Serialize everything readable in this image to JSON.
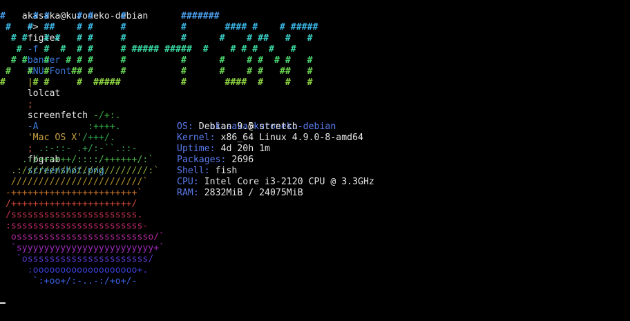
{
  "prompt": {
    "user_host": "akasaka@kuroneko-debian",
    "path": "~>",
    "cmd_figlet": "figlet",
    "arg_f": "-f",
    "arg_banner": "banner",
    "arg_font": "XNU-Font",
    "pipe": "|",
    "cmd_lolcat": "lolcat",
    "sep1": ";",
    "cmd_screenfetch": "screenfetch",
    "arg_A": "-A",
    "arg_os": "'Mac OS X'",
    "sep2": ";",
    "cmd_fbgrab": "fbgrab",
    "arg_file": "screenshot.png"
  },
  "banner_lines": [
    "#     # #     # #     #          #######",
    " #   #  ##    # #     #          #       #### #    # #####",
    "  # #   # #   # #     #          #      #    # ##   #   #",
    "   #    #  #  # #     # ##### #####  #    # # #  #   #",
    "  # #   #   # # #     #          #      #    # #  # #   #",
    " #   #  #    ## #     #          #      #    # #   ##   #",
    "#     # #     #  #####           #       ####  #    #   #"
  ],
  "logo_lines": [
    "                 -/+:.",
    "                :++++.",
    "               /+++/.",
    "       .:-::- .+/:-``.::-",
    "    .:/++++++/::::/++++++/:`",
    "  .:///////////////////////:`",
    "  ////////////////////////`",
    " -+++++++++++++++++++++++`",
    " /++++++++++++++++++++++/",
    " /sssssssssssssssssssssss.",
    " :ssssssssssssssssssssssss-",
    "  osssssssssssssssssssssssso/`",
    "  `syyyyyyyyyyyyyyyyyyyyyyyy+`",
    "   `ossssssssssssssssssssss/",
    "     :ooooooooooooooooooo+.",
    "      `:+oo+/:-..-:/+o+/-"
  ],
  "logo_colors": [
    "#3ba83b",
    "#34b044",
    "#2ea84c",
    "#3aa65a",
    "#4bb84f",
    "#8aa83a",
    "#b3962e",
    "#c9742a",
    "#d24a36",
    "#c4324c",
    "#c02a6a",
    "#b02a9a",
    "#9a2ab8",
    "#5a3ad0",
    "#3a40d8",
    "#3a60e0"
  ],
  "banner_colors": [
    "#4aa0f0",
    "#3ab8e8",
    "#3ad0c8",
    "#3ad8a0",
    "#4ad870",
    "#6ad050",
    "#8ad040"
  ],
  "prompt_colors": {
    "user_host": "#e6e6e6",
    "figlet": "#e6e6e6",
    "args": "#3a78d8",
    "pipe": "#d8c84a",
    "lolcat": "#e6e6e6",
    "sep": "#c85a3a",
    "screenfetch": "#e6e6e6",
    "string": "#c8a040",
    "fbgrab": "#e6e6e6",
    "file": "#5ab8e8"
  },
  "info": {
    "user": "akasaka",
    "at": "@",
    "host": "kuroneko-debian",
    "rows": [
      {
        "key": "OS:",
        "value": "Debian 9.5 stretch"
      },
      {
        "key": "Kernel:",
        "value": "x86_64 Linux 4.9.0-8-amd64"
      },
      {
        "key": "Uptime:",
        "value": "4d 20h 1m"
      },
      {
        "key": "Packages:",
        "value": "2696"
      },
      {
        "key": "Shell:",
        "value": "fish"
      },
      {
        "key": "CPU:",
        "value": "Intel Core i3-2120 CPU @ 3.3GHz"
      },
      {
        "key": "RAM:",
        "value": "2832MiB / 24075MiB"
      }
    ]
  },
  "cursor_glyph": "underline-cursor"
}
